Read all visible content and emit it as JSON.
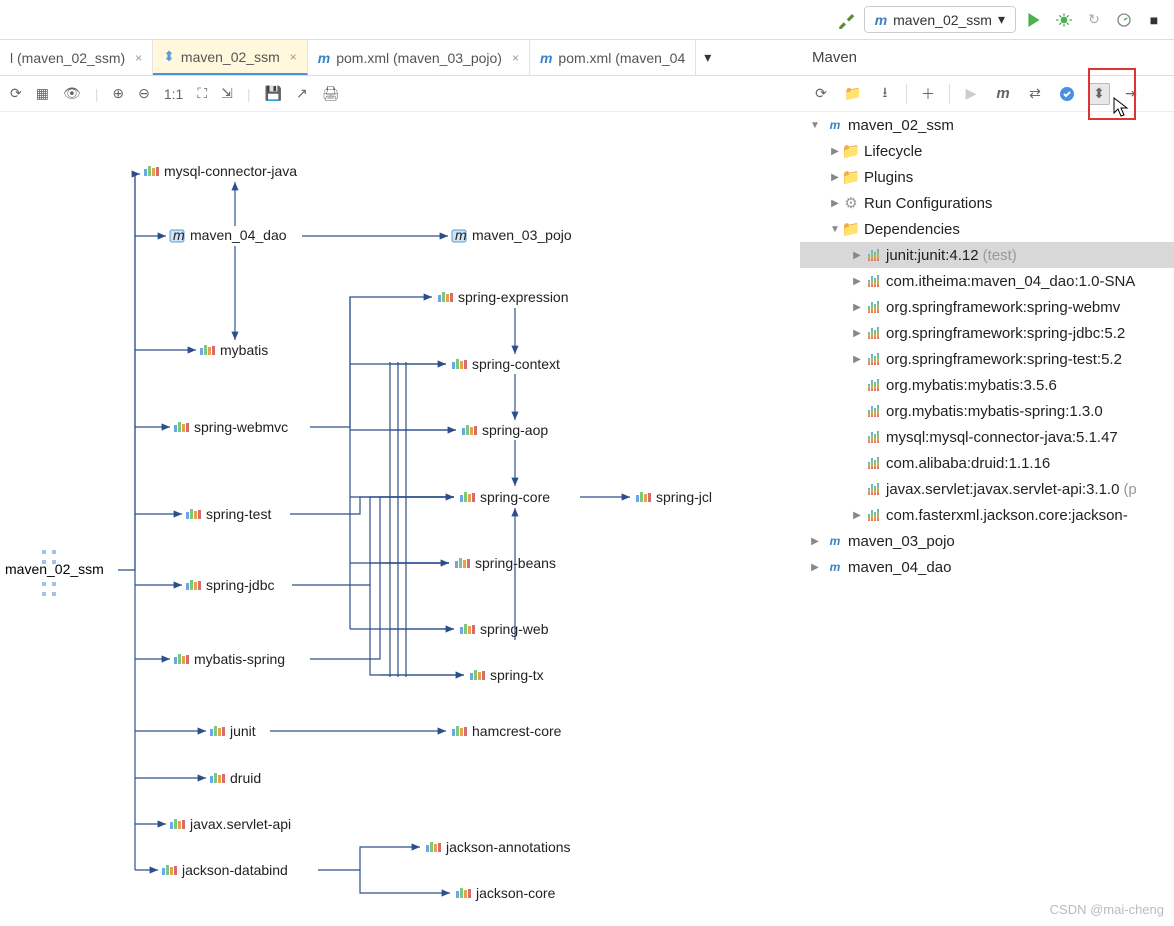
{
  "top": {
    "run_config": "maven_02_ssm"
  },
  "tabs": [
    {
      "label": "l (maven_02_ssm)",
      "active": false
    },
    {
      "label": "maven_02_ssm",
      "active": true
    },
    {
      "label": "pom.xml (maven_03_pojo)",
      "active": false
    },
    {
      "label": "pom.xml (maven_04",
      "active": false
    }
  ],
  "editor_toolbar": {
    "zoom": "1:1"
  },
  "maven_panel": {
    "title": "Maven"
  },
  "tree": {
    "root": "maven_02_ssm",
    "lifecycle": "Lifecycle",
    "plugins": "Plugins",
    "runconfig": "Run Configurations",
    "dependencies": "Dependencies",
    "deps": [
      {
        "label": "junit:junit:4.12",
        "hint": "(test)",
        "expandable": true,
        "selected": true
      },
      {
        "label": "com.itheima:maven_04_dao:1.0-SNA",
        "hint": "",
        "expandable": true
      },
      {
        "label": "org.springframework:spring-webmv",
        "hint": "",
        "expandable": true
      },
      {
        "label": "org.springframework:spring-jdbc:5.2",
        "hint": "",
        "expandable": true
      },
      {
        "label": "org.springframework:spring-test:5.2",
        "hint": "",
        "expandable": true
      },
      {
        "label": "org.mybatis:mybatis:3.5.6",
        "hint": "",
        "expandable": false
      },
      {
        "label": "org.mybatis:mybatis-spring:1.3.0",
        "hint": "",
        "expandable": false
      },
      {
        "label": "mysql:mysql-connector-java:5.1.47",
        "hint": "",
        "expandable": false
      },
      {
        "label": "com.alibaba:druid:1.1.16",
        "hint": "",
        "expandable": false
      },
      {
        "label": "javax.servlet:javax.servlet-api:3.1.0",
        "hint": "(p",
        "expandable": false
      },
      {
        "label": "com.fasterxml.jackson.core:jackson-",
        "hint": "",
        "expandable": true
      }
    ],
    "siblings": [
      "maven_03_pojo",
      "maven_04_dao"
    ]
  },
  "diagram": {
    "root": "maven_02_ssm",
    "nodes": {
      "mysql": "mysql-connector-java",
      "dao": "maven_04_dao",
      "pojo": "maven_03_pojo",
      "mybatis": "mybatis",
      "webmvc": "spring-webmvc",
      "test": "spring-test",
      "jdbc": "spring-jdbc",
      "mybatis_spring": "mybatis-spring",
      "junit": "junit",
      "druid": "druid",
      "servlet": "javax.servlet-api",
      "jackson_db": "jackson-databind",
      "expr": "spring-expression",
      "ctx": "spring-context",
      "aop": "spring-aop",
      "core": "spring-core",
      "beans": "spring-beans",
      "web": "spring-web",
      "tx": "spring-tx",
      "jcl": "spring-jcl",
      "hamcrest": "hamcrest-core",
      "j_ann": "jackson-annotations",
      "j_core": "jackson-core"
    }
  },
  "watermark": "CSDN @mai-cheng"
}
